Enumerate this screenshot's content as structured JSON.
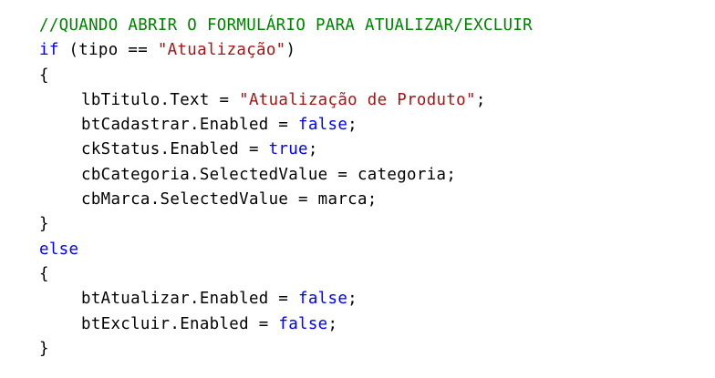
{
  "code": {
    "lines": [
      {
        "indent": false,
        "tokens": [
          {
            "type": "comment",
            "text": "//QUANDO ABRIR O FORMULÁRIO PARA ATUALIZAR/EXCLUIR"
          }
        ]
      },
      {
        "indent": false,
        "tokens": [
          {
            "type": "keyword",
            "text": "if"
          },
          {
            "type": "plain",
            "text": " (tipo == "
          },
          {
            "type": "string",
            "text": "\"Atualização\""
          },
          {
            "type": "plain",
            "text": ")"
          }
        ]
      },
      {
        "indent": false,
        "tokens": [
          {
            "type": "plain",
            "text": "{"
          }
        ]
      },
      {
        "indent": true,
        "tokens": [
          {
            "type": "plain",
            "text": "lbTitulo.Text = "
          },
          {
            "type": "string",
            "text": "\"Atualização de Produto\""
          },
          {
            "type": "plain",
            "text": ";"
          }
        ]
      },
      {
        "indent": true,
        "tokens": [
          {
            "type": "plain",
            "text": "btCadastrar.Enabled = "
          },
          {
            "type": "keyword",
            "text": "false"
          },
          {
            "type": "plain",
            "text": ";"
          }
        ]
      },
      {
        "indent": true,
        "tokens": [
          {
            "type": "plain",
            "text": "ckStatus.Enabled = "
          },
          {
            "type": "keyword",
            "text": "true"
          },
          {
            "type": "plain",
            "text": ";"
          }
        ]
      },
      {
        "indent": true,
        "tokens": [
          {
            "type": "plain",
            "text": "cbCategoria.SelectedValue = categoria;"
          }
        ]
      },
      {
        "indent": true,
        "tokens": [
          {
            "type": "plain",
            "text": "cbMarca.SelectedValue = marca;"
          }
        ]
      },
      {
        "indent": false,
        "tokens": [
          {
            "type": "plain",
            "text": "}"
          }
        ]
      },
      {
        "indent": false,
        "tokens": [
          {
            "type": "keyword",
            "text": "else"
          }
        ]
      },
      {
        "indent": false,
        "tokens": [
          {
            "type": "plain",
            "text": "{"
          }
        ]
      },
      {
        "indent": true,
        "tokens": [
          {
            "type": "plain",
            "text": "btAtualizar.Enabled = "
          },
          {
            "type": "keyword",
            "text": "false"
          },
          {
            "type": "plain",
            "text": ";"
          }
        ]
      },
      {
        "indent": true,
        "tokens": [
          {
            "type": "plain",
            "text": "btExcluir.Enabled = "
          },
          {
            "type": "keyword",
            "text": "false"
          },
          {
            "type": "plain",
            "text": ";"
          }
        ]
      },
      {
        "indent": false,
        "tokens": [
          {
            "type": "plain",
            "text": "}"
          }
        ]
      }
    ]
  },
  "colors": {
    "background": "#ffffff",
    "comment": "#008000",
    "keyword": "#0000ff",
    "string": "#a31515",
    "plain": "#000000"
  }
}
